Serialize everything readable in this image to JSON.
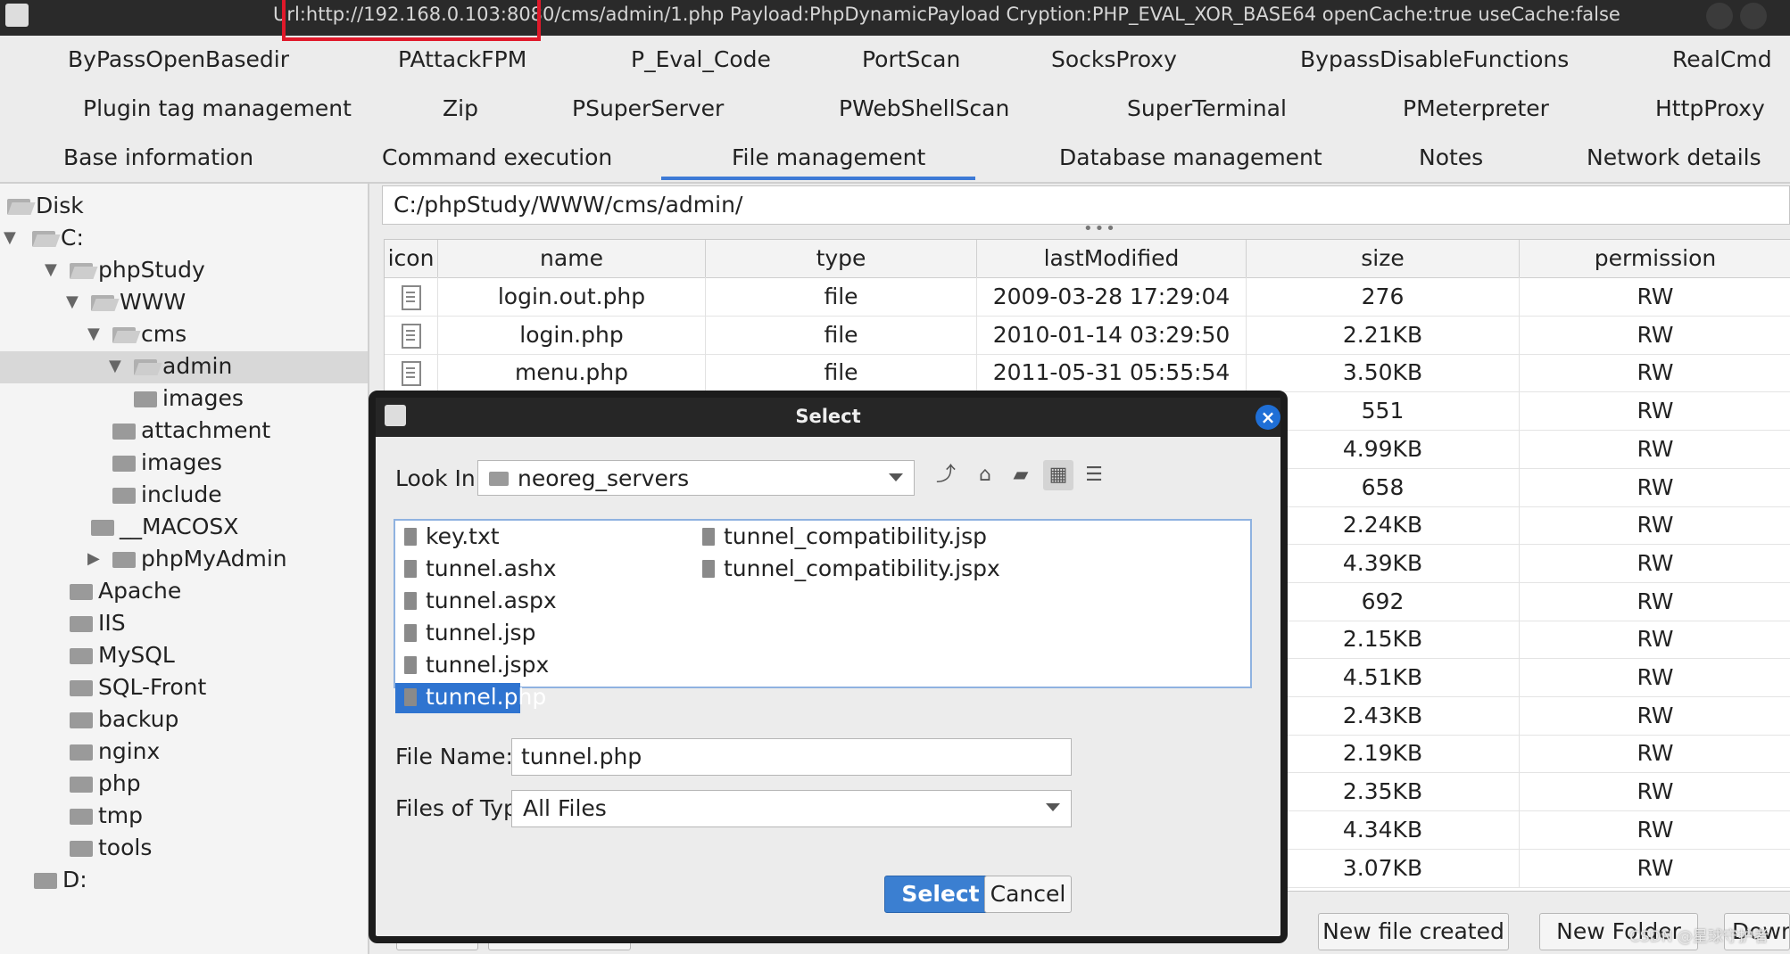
{
  "window": {
    "title_url": "Url:http://192.168.0.103:8080/cms/admin/1.php Payload:PhpDynamicPayload Cryption:PHP_EVAL_XOR_BASE64 openCache:true useCache:false"
  },
  "plugin_tabs_row1": [
    "ByPassOpenBasedir",
    "PAttackFPM",
    "P_Eval_Code",
    "PortScan",
    "SocksProxy",
    "BypassDisableFunctions",
    "RealCmd"
  ],
  "plugin_tabs_row2": [
    "Plugin tag management",
    "Zip",
    "PSuperServer",
    "PWebShellScan",
    "SuperTerminal",
    "PMeterpreter",
    "HttpProxy"
  ],
  "main_tabs": [
    "Base information",
    "Command execution",
    "File management",
    "Database management",
    "Notes",
    "Network details"
  ],
  "active_main_tab": "File management",
  "tree": [
    {
      "label": "Disk",
      "level": 0,
      "arrow": "",
      "open": true
    },
    {
      "label": "C:",
      "level": 0,
      "arrow": "▼",
      "open": true
    },
    {
      "label": "phpStudy",
      "level": 1,
      "arrow": "▼",
      "open": true
    },
    {
      "label": "WWW",
      "level": 2,
      "arrow": "▼",
      "open": true
    },
    {
      "label": "cms",
      "level": 3,
      "arrow": "▼",
      "open": true
    },
    {
      "label": "admin",
      "level": 4,
      "arrow": "▼",
      "open": true,
      "selected": true
    },
    {
      "label": "images",
      "level": 5,
      "arrow": ""
    },
    {
      "label": "attachment",
      "level": 4,
      "arrow": ""
    },
    {
      "label": "images",
      "level": 4,
      "arrow": ""
    },
    {
      "label": "include",
      "level": 4,
      "arrow": ""
    },
    {
      "label": "__MACOSX",
      "level": 3,
      "arrow": ""
    },
    {
      "label": "phpMyAdmin",
      "level": 3,
      "arrow": "▶"
    },
    {
      "label": "Apache",
      "level": 2,
      "arrow": ""
    },
    {
      "label": "IIS",
      "level": 2,
      "arrow": ""
    },
    {
      "label": "MySQL",
      "level": 2,
      "arrow": ""
    },
    {
      "label": "SQL-Front",
      "level": 2,
      "arrow": ""
    },
    {
      "label": "backup",
      "level": 2,
      "arrow": ""
    },
    {
      "label": "nginx",
      "level": 2,
      "arrow": ""
    },
    {
      "label": "php",
      "level": 2,
      "arrow": ""
    },
    {
      "label": "tmp",
      "level": 2,
      "arrow": ""
    },
    {
      "label": "tools",
      "level": 2,
      "arrow": ""
    },
    {
      "label": "D:",
      "level": 0,
      "arrow": ""
    }
  ],
  "path": "C:/phpStudy/WWW/cms/admin/",
  "table": {
    "columns": [
      "icon",
      "name",
      "type",
      "lastModified",
      "size",
      "permission"
    ],
    "rows": [
      {
        "name": "login.out.php",
        "type": "file",
        "lastModified": "2009-03-28 17:29:04",
        "size": "276",
        "permission": "RW"
      },
      {
        "name": "login.php",
        "type": "file",
        "lastModified": "2010-01-14 03:29:50",
        "size": "2.21KB",
        "permission": "RW"
      },
      {
        "name": "menu.php",
        "type": "file",
        "lastModified": "2011-05-31 05:55:54",
        "size": "3.50KB",
        "permission": "RW"
      },
      {
        "name": "",
        "type": "",
        "lastModified": "",
        "size": "551",
        "permission": "RW"
      },
      {
        "name": "",
        "type": "",
        "lastModified": "",
        "size": "4.99KB",
        "permission": "RW"
      },
      {
        "name": "",
        "type": "",
        "lastModified": "",
        "size": "658",
        "permission": "RW"
      },
      {
        "name": "",
        "type": "",
        "lastModified": "",
        "size": "2.24KB",
        "permission": "RW"
      },
      {
        "name": "",
        "type": "",
        "lastModified": "",
        "size": "4.39KB",
        "permission": "RW"
      },
      {
        "name": "",
        "type": "",
        "lastModified": "",
        "size": "692",
        "permission": "RW"
      },
      {
        "name": "",
        "type": "",
        "lastModified": "",
        "size": "2.15KB",
        "permission": "RW"
      },
      {
        "name": "",
        "type": "",
        "lastModified": "",
        "size": "4.51KB",
        "permission": "RW"
      },
      {
        "name": "",
        "type": "",
        "lastModified": "",
        "size": "2.43KB",
        "permission": "RW"
      },
      {
        "name": "",
        "type": "",
        "lastModified": "",
        "size": "2.19KB",
        "permission": "RW"
      },
      {
        "name": "",
        "type": "",
        "lastModified": "",
        "size": "2.35KB",
        "permission": "RW"
      },
      {
        "name": "",
        "type": "",
        "lastModified": "",
        "size": "4.34KB",
        "permission": "RW"
      },
      {
        "name": "",
        "type": "",
        "lastModified": "",
        "size": "3.07KB",
        "permission": "RW"
      }
    ]
  },
  "bottom_buttons": [
    "New file created",
    "New Folder",
    "Down"
  ],
  "watermark": "CSDN @星球守护者",
  "dialog": {
    "title": "Select",
    "look_in_label": "Look In:",
    "look_in_value": "neoreg_servers",
    "files_col1": [
      "key.txt",
      "tunnel.ashx",
      "tunnel.aspx",
      "tunnel.jsp",
      "tunnel.jspx",
      "tunnel.php"
    ],
    "files_col2": [
      "tunnel_compatibility.jsp",
      "tunnel_compatibility.jspx"
    ],
    "selected_file": "tunnel.php",
    "file_name_label": "File Name:",
    "file_name_value": "tunnel.php",
    "file_type_label": "Files of Type:",
    "file_type_value": "All Files",
    "select_label": "Select",
    "cancel_label": "Cancel"
  },
  "colors": {
    "accent": "#3d7ad6",
    "selection": "#2f74d0",
    "highlight_box": "#e0192a"
  }
}
